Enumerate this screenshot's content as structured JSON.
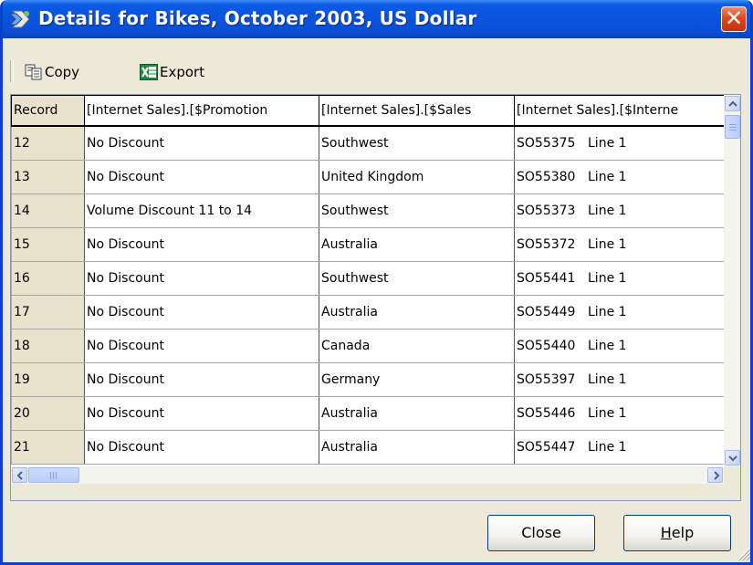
{
  "window": {
    "title": "Details for Bikes, October 2003, US Dollar",
    "close_glyph": "✕",
    "title_icon": "drillthrough-icon"
  },
  "toolbar": {
    "copy_label": "Copy",
    "copy_icon": "copy-icon",
    "export_label": "Export",
    "export_icon": "excel-export-icon"
  },
  "grid": {
    "columns": [
      "Record",
      "[Internet Sales].[$Promotion",
      "[Internet Sales].[$Sales",
      "[Internet Sales].[$Interne"
    ],
    "rows": [
      {
        "record": "12",
        "promotion": "No Discount",
        "territory": "Southwest",
        "order": "SO55375",
        "line": "Line 1"
      },
      {
        "record": "13",
        "promotion": "No Discount",
        "territory": "United Kingdom",
        "order": "SO55380",
        "line": "Line 1"
      },
      {
        "record": "14",
        "promotion": "Volume Discount 11 to 14",
        "territory": "Southwest",
        "order": "SO55373",
        "line": "Line 1"
      },
      {
        "record": "15",
        "promotion": "No Discount",
        "territory": "Australia",
        "order": "SO55372",
        "line": "Line 1"
      },
      {
        "record": "16",
        "promotion": "No Discount",
        "territory": "Southwest",
        "order": "SO55441",
        "line": "Line 1"
      },
      {
        "record": "17",
        "promotion": "No Discount",
        "territory": "Australia",
        "order": "SO55449",
        "line": "Line 1"
      },
      {
        "record": "18",
        "promotion": "No Discount",
        "territory": "Canada",
        "order": "SO55440",
        "line": "Line 1"
      },
      {
        "record": "19",
        "promotion": "No Discount",
        "territory": "Germany",
        "order": "SO55397",
        "line": "Line 1"
      },
      {
        "record": "20",
        "promotion": "No Discount",
        "territory": "Australia",
        "order": "SO55446",
        "line": "Line 1"
      },
      {
        "record": "21",
        "promotion": "No Discount",
        "territory": "Australia",
        "order": "SO55447",
        "line": "Line 1"
      }
    ]
  },
  "buttons": {
    "close_label": "Close",
    "help_mnemonic": "H",
    "help_rest": "elp"
  },
  "colors": {
    "titlebar": "#0a53db",
    "window_bg": "#ece9d8",
    "close_button": "#e0481f",
    "record_column": "#e9e2cc"
  }
}
